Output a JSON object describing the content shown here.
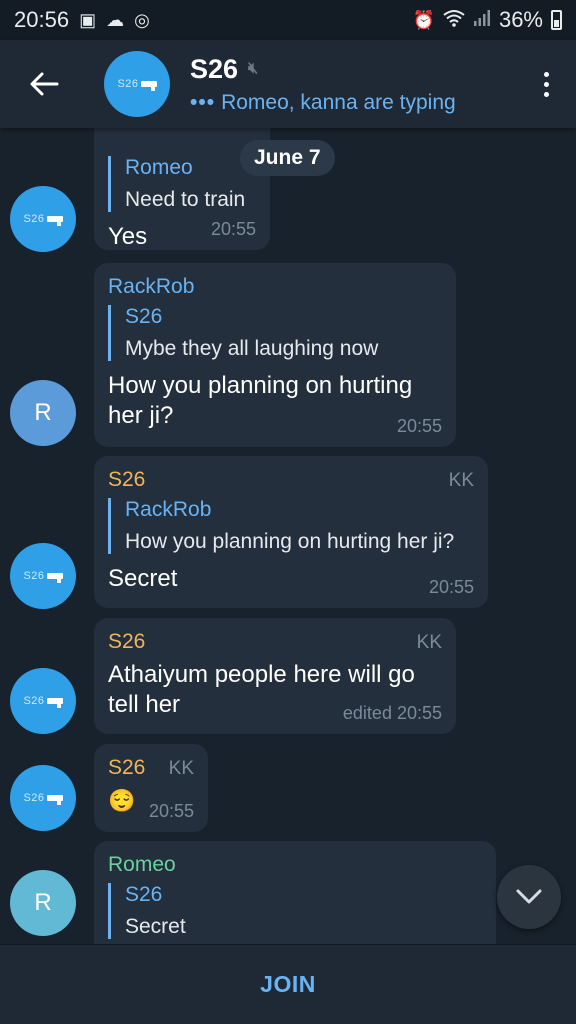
{
  "status_bar": {
    "time": "20:56",
    "battery": "36%",
    "left_icons": [
      "image-icon",
      "cloud-icon",
      "whatsapp-icon"
    ],
    "right_icons": [
      "alarm-icon",
      "wifi-icon",
      "signal-icon",
      "battery-icon"
    ]
  },
  "header": {
    "title": "S26",
    "typing_status": "Romeo, kanna are typing",
    "avatar_logo_text": "S26",
    "muted": true
  },
  "date_chip": "June 7",
  "messages": [
    {
      "reply_name": "Romeo",
      "reply_text": "Need to train",
      "text": "Yes",
      "time": "20:55"
    },
    {
      "sender": "RackRob",
      "reply_name": "S26",
      "reply_text": "Mybe they all laughing now",
      "text": "How you planning on hurting her ji?",
      "time": "20:55",
      "avatar_letter": "R"
    },
    {
      "sender": "S26",
      "tag": "KK",
      "reply_name": "RackRob",
      "reply_text": "How you planning on hurting her ji?",
      "text": "Secret",
      "time": "20:55"
    },
    {
      "sender": "S26",
      "tag": "KK",
      "text": "Athaiyum people here will go tell her",
      "time": "edited 20:55"
    },
    {
      "sender": "S26",
      "tag": "KK",
      "text": "😌",
      "time": "20:55"
    },
    {
      "sender": "Romeo",
      "reply_name": "S26",
      "reply_text": "Secret",
      "avatar_letter": "R"
    }
  ],
  "bottom": {
    "join_label": "JOIN"
  },
  "colors": {
    "background": "#18222d",
    "header": "#1f2936",
    "bubble": "#232f3c",
    "accent_blue": "#6ab3f3",
    "name_orange": "#f0b45a",
    "name_green": "#6bd19e",
    "logo_avatar": "#2f9fe8"
  }
}
